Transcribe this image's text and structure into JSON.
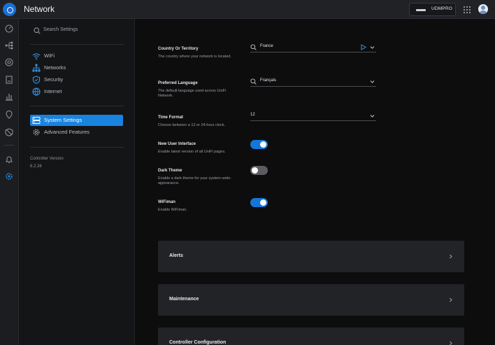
{
  "topbar": {
    "app_title": "Network",
    "device_name": "UDMPRO",
    "logo_icon": "ubiquiti-logo-icon",
    "apps_icon": "app-grid-icon",
    "avatar_icon": "user-avatar-icon"
  },
  "rail": {
    "icons": [
      "dashboard-icon",
      "topology-icon",
      "devices-icon",
      "clients-icon",
      "statistics-icon",
      "insights-icon",
      "traffic-management-icon",
      "alerts-icon",
      "settings-icon"
    ],
    "active_icon": "settings-icon"
  },
  "sidebar": {
    "search_placeholder": "Search Settings",
    "items": [
      {
        "label": "WiFi",
        "icon": "wifi-icon"
      },
      {
        "label": "Networks",
        "icon": "networks-icon"
      },
      {
        "label": "Security",
        "icon": "shield-icon"
      },
      {
        "label": "Internet",
        "icon": "globe-icon"
      }
    ],
    "system_items": [
      {
        "label": "System Settings",
        "icon": "system-settings-icon",
        "active": true
      },
      {
        "label": "Advanced Features",
        "icon": "advanced-features-icon",
        "active": false
      }
    ],
    "controller_version_label": "Controller Version",
    "controller_version": "6.2.26"
  },
  "settings": {
    "country": {
      "label": "Country Or Territory",
      "description": "The country where your network is located.",
      "value": "France"
    },
    "language": {
      "label": "Preferred Language",
      "description": "The default language used across UniFi Network.",
      "value": "Français"
    },
    "time_format": {
      "label": "Time Format",
      "description": "Choose between a 12 or 24-hour clock.",
      "value": "12"
    },
    "new_ui": {
      "label": "New User Interface",
      "description": "Enable latest version of all UniFi pages.",
      "enabled": true
    },
    "dark_theme": {
      "label": "Dark Theme",
      "description": "Enable a dark theme for your system-wide-appearance.",
      "enabled": false
    },
    "wifiman": {
      "label": "WiFiman",
      "description": "Enable WiFiman.",
      "enabled": true
    }
  },
  "panels": [
    {
      "title": "Alerts"
    },
    {
      "title": "Maintenance"
    },
    {
      "title": "Controller Configuration"
    }
  ],
  "colors": {
    "accent": "#1983e0",
    "toggle_on": "#1676d8",
    "toggle_off": "#5b5d63",
    "background": "#0d0d0e",
    "panel": "#222326"
  }
}
